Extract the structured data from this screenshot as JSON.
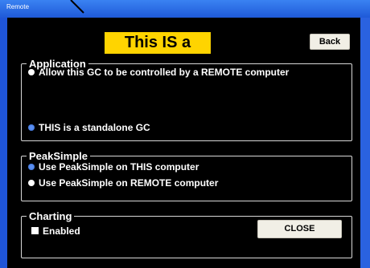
{
  "window": {
    "title": "Remote",
    "badge_text": "This IS a GCC",
    "back_label": "Back"
  },
  "application": {
    "legend": "Application",
    "options": [
      {
        "label": "Allow this GC to be controlled by a REMOTE computer",
        "selected": false
      },
      {
        "label": "THIS is a standalone GC",
        "selected": true
      }
    ]
  },
  "peaksimple": {
    "legend": "PeakSimple",
    "options": [
      {
        "label": "Use PeakSimple on THIS computer",
        "selected": true
      },
      {
        "label": "Use PeakSimple on REMOTE computer",
        "selected": false
      }
    ]
  },
  "charting": {
    "legend": "Charting",
    "enabled_label": "Enabled",
    "enabled_checked": false,
    "close_label": "CLOSE"
  },
  "colors": {
    "badge_bg": "#ffd400",
    "selected_radio": "#5b8ff2",
    "titlebar": "#1f5ad8"
  }
}
